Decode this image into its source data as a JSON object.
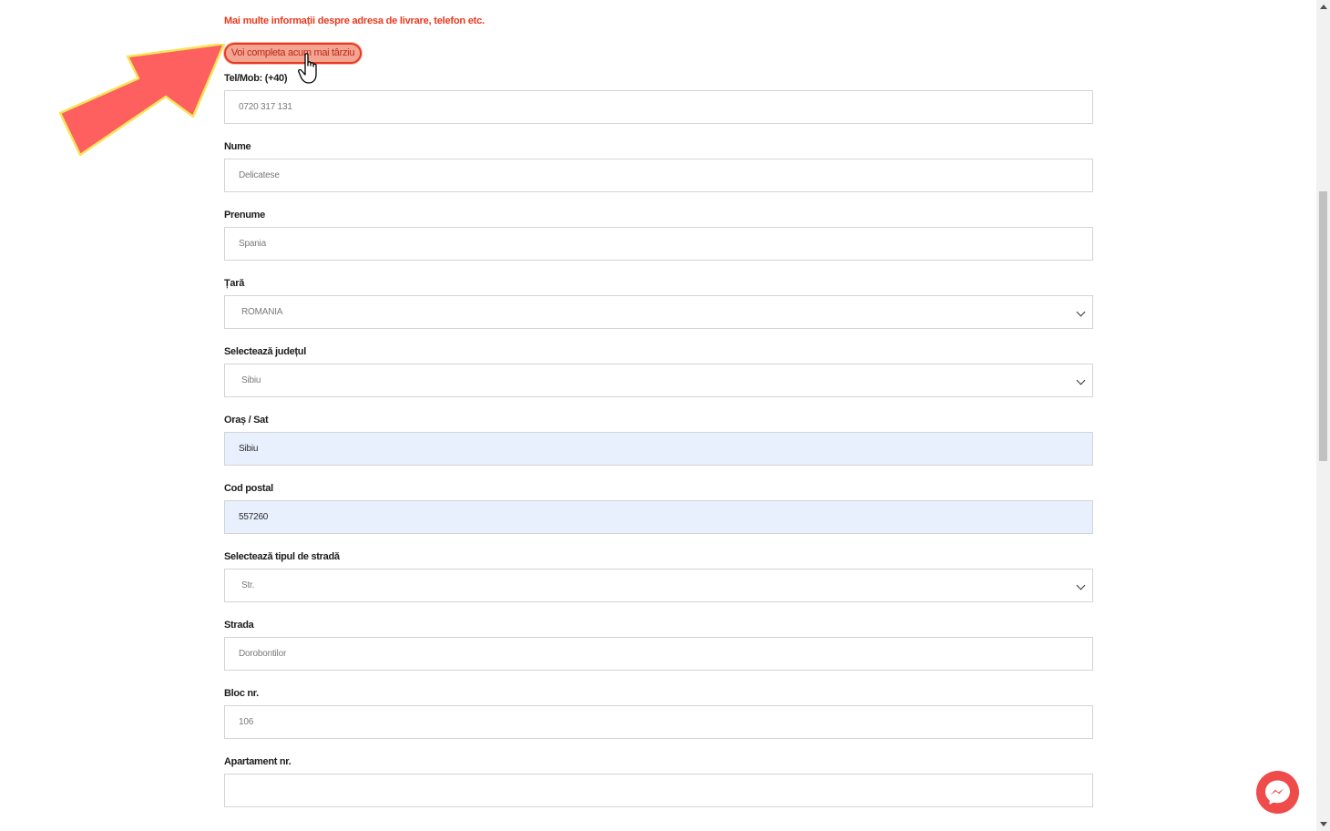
{
  "form": {
    "info_link": "Mai multe informații despre adresa de livrare, telefon etc.",
    "later_button": "Voi completa acum mai târziu",
    "fields": [
      {
        "label": "Tel/Mob: (+40)",
        "value": "0720 317 131",
        "type": "input"
      },
      {
        "label": "Nume",
        "value": "Delicatese",
        "type": "input"
      },
      {
        "label": "Prenume",
        "value": "Spania",
        "type": "input"
      },
      {
        "label": "Țară",
        "value": "ROMANIA",
        "type": "select"
      },
      {
        "label": "Selectează județul",
        "value": "Sibiu",
        "type": "select"
      },
      {
        "label": "Oraș / Sat",
        "value": "Sibiu",
        "type": "input-autofill"
      },
      {
        "label": "Cod postal",
        "value": "557260",
        "type": "input-autofill"
      },
      {
        "label": "Selectează tipul de stradă",
        "value": "Str.",
        "type": "select"
      },
      {
        "label": "Strada",
        "value": "Dorobontilor",
        "type": "input"
      },
      {
        "label": "Bloc nr.",
        "value": "106",
        "type": "input"
      },
      {
        "label": "Apartament nr.",
        "value": "",
        "type": "input"
      }
    ]
  },
  "icons": {
    "arrow": "red-arrow-icon",
    "cursor": "hand-pointer-icon",
    "messenger": "messenger-icon"
  },
  "colors": {
    "accent": "#e8381e",
    "autofill_bg": "#e8f0fe",
    "arrow_fill": "#fe5f5f",
    "arrow_outline": "#f5e55a",
    "messenger_bg": "#ef4b4b"
  }
}
